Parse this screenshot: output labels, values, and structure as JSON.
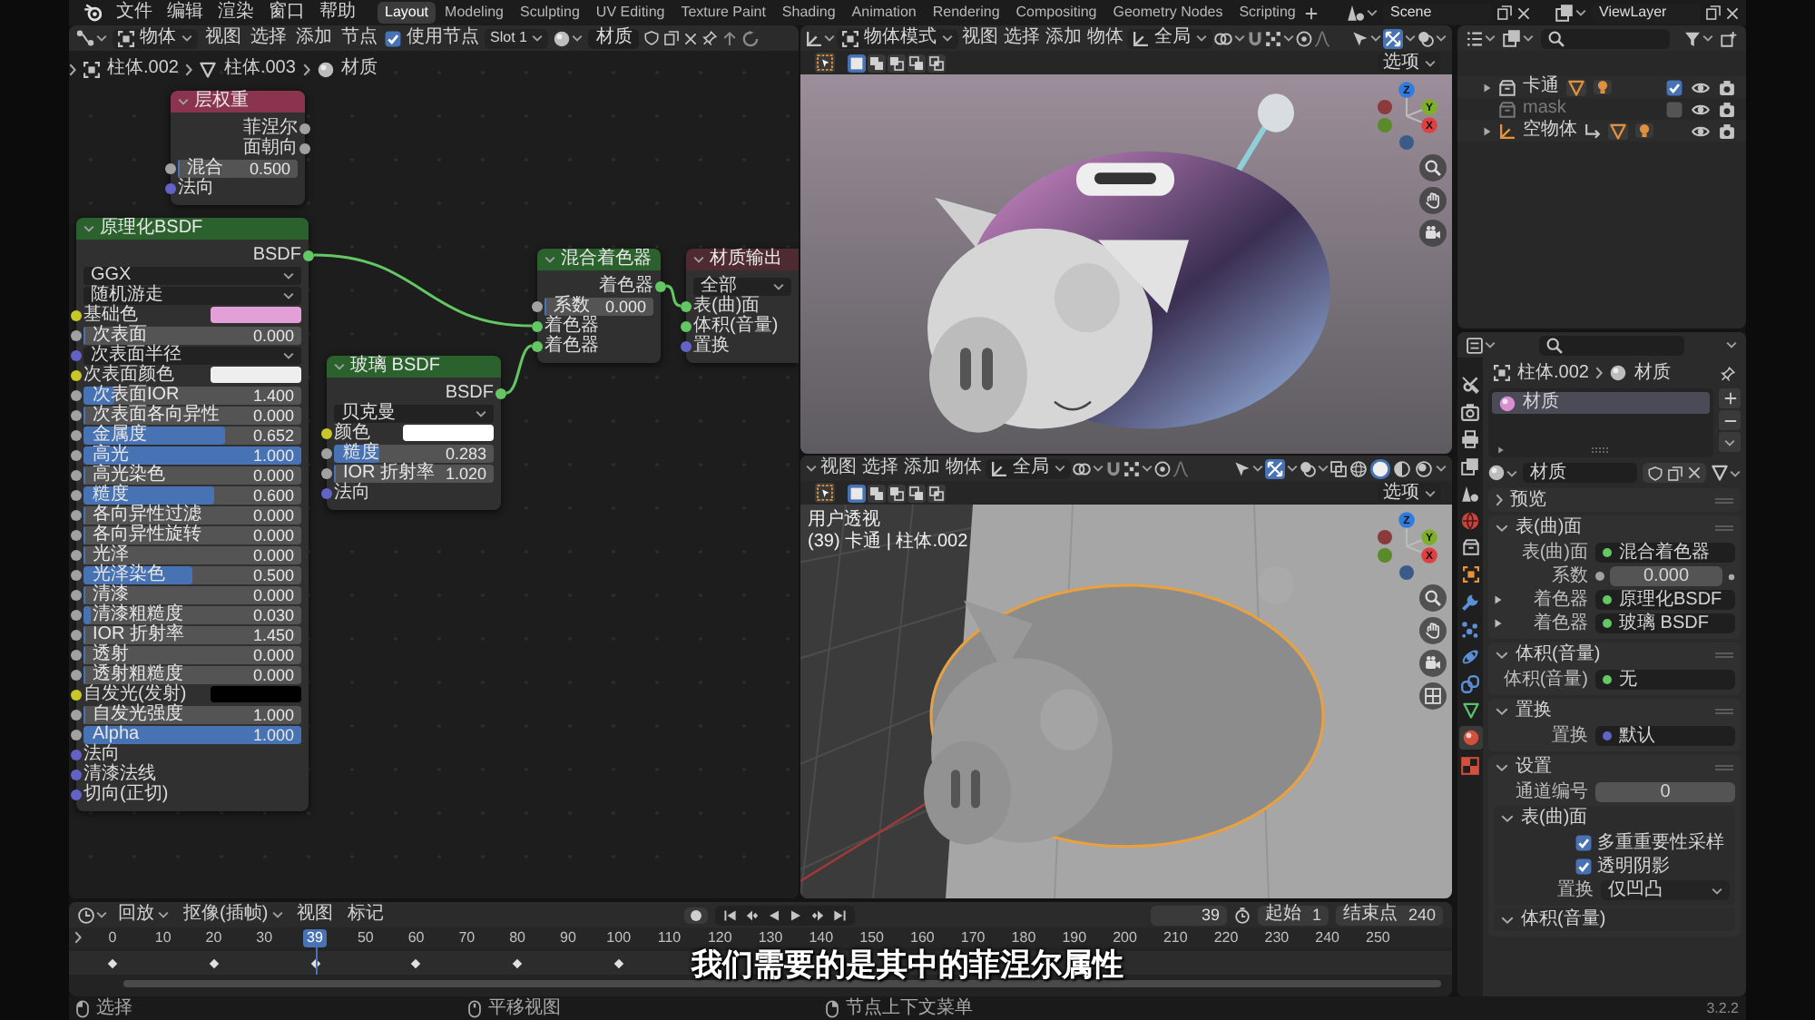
{
  "topbar": {
    "menus": [
      "文件",
      "编辑",
      "渲染",
      "窗口",
      "帮助"
    ],
    "workspaces": [
      {
        "label": "Layout",
        "selected": true
      },
      {
        "label": "Modeling",
        "selected": false
      },
      {
        "label": "Sculpting",
        "selected": false
      },
      {
        "label": "UV Editing",
        "selected": false
      },
      {
        "label": "Texture Paint",
        "selected": false
      },
      {
        "label": "Shading",
        "selected": false
      },
      {
        "label": "Animation",
        "selected": false
      },
      {
        "label": "Rendering",
        "selected": false
      },
      {
        "label": "Compositing",
        "selected": false
      },
      {
        "label": "Geometry Nodes",
        "selected": false
      },
      {
        "label": "Scripting",
        "selected": false
      }
    ],
    "scene": "Scene",
    "view_layer": "ViewLayer"
  },
  "node_editor": {
    "header": {
      "object_menu": "物体",
      "menus": [
        "视图",
        "选择",
        "添加",
        "节点"
      ],
      "use_nodes": {
        "label": "使用节点",
        "checked": true
      },
      "slot": "Slot 1",
      "material": "材质"
    },
    "breadcrumb": [
      {
        "label": "柱体.002",
        "kind": "object"
      },
      {
        "label": "柱体.003",
        "kind": "mesh"
      },
      {
        "label": "材质",
        "kind": "material"
      }
    ],
    "nodes": [
      {
        "title": "层权重",
        "kind": "input",
        "rows": [
          {
            "kind": "output",
            "label": "菲涅尔",
            "color": "#a1a1a1"
          },
          {
            "kind": "output",
            "label": "面朝向",
            "color": "#a1a1a1"
          },
          {
            "kind": "value",
            "label": "混合",
            "value": "0.500",
            "level": 0,
            "color": "#a1a1a1"
          },
          {
            "kind": "socket",
            "label": "法向",
            "color": "#6363c7"
          }
        ]
      },
      {
        "title": "原理化BSDF",
        "kind": "shader",
        "rows": [
          {
            "kind": "output",
            "label": "BSDF",
            "color": "#63c763",
            "linked": true
          },
          {
            "kind": "dropdown",
            "value": "GGX"
          },
          {
            "kind": "dropdown",
            "value": "随机游走"
          },
          {
            "kind": "color",
            "label": "基础色",
            "color": "#e3a0d8"
          },
          {
            "kind": "value",
            "label": "次表面",
            "value": "0.000",
            "level": 0,
            "color": "#a1a1a1"
          },
          {
            "kind": "menu",
            "label": "次表面半径",
            "color": "#6363c7"
          },
          {
            "kind": "color",
            "label": "次表面颜色",
            "color": "#eeeeee"
          },
          {
            "kind": "value",
            "label": "次表面IOR",
            "value": "1.400",
            "level": 0.14,
            "color": "#a1a1a1"
          },
          {
            "kind": "value",
            "label": "次表面各向异性",
            "value": "0.000",
            "level": 0,
            "color": "#a1a1a1"
          },
          {
            "kind": "value",
            "label": "金属度",
            "value": "0.652",
            "level": 0.652,
            "color": "#a1a1a1"
          },
          {
            "kind": "value",
            "label": "高光",
            "value": "1.000",
            "level": 1,
            "color": "#a1a1a1"
          },
          {
            "kind": "value",
            "label": "高光染色",
            "value": "0.000",
            "level": 0,
            "color": "#a1a1a1"
          },
          {
            "kind": "value",
            "label": "糙度",
            "value": "0.600",
            "level": 0.6,
            "color": "#a1a1a1"
          },
          {
            "kind": "value",
            "label": "各向异性过滤",
            "value": "0.000",
            "level": 0,
            "color": "#a1a1a1"
          },
          {
            "kind": "value",
            "label": "各向异性旋转",
            "value": "0.000",
            "level": 0,
            "color": "#a1a1a1"
          },
          {
            "kind": "value",
            "label": "光泽",
            "value": "0.000",
            "level": 0,
            "color": "#a1a1a1"
          },
          {
            "kind": "value",
            "label": "光泽染色",
            "value": "0.500",
            "level": 0.5,
            "color": "#a1a1a1"
          },
          {
            "kind": "value",
            "label": "清漆",
            "value": "0.000",
            "level": 0,
            "color": "#a1a1a1"
          },
          {
            "kind": "value",
            "label": "清漆粗糙度",
            "value": "0.030",
            "level": 0.03,
            "color": "#a1a1a1"
          },
          {
            "kind": "value",
            "label": "IOR 折射率",
            "value": "1.450",
            "level": 0,
            "color": "#a1a1a1"
          },
          {
            "kind": "value",
            "label": "透射",
            "value": "0.000",
            "level": 0,
            "color": "#a1a1a1"
          },
          {
            "kind": "value",
            "label": "透射粗糙度",
            "value": "0.000",
            "level": 0,
            "color": "#a1a1a1"
          },
          {
            "kind": "color",
            "label": "自发光(发射)",
            "color": "#000000"
          },
          {
            "kind": "value",
            "label": "自发光强度",
            "value": "1.000",
            "level": 0,
            "color": "#a1a1a1"
          },
          {
            "kind": "value",
            "label": "Alpha",
            "value": "1.000",
            "level": 1,
            "color": "#a1a1a1"
          },
          {
            "kind": "socket",
            "label": "法向",
            "color": "#6363c7"
          },
          {
            "kind": "socket",
            "label": "清漆法线",
            "color": "#6363c7"
          },
          {
            "kind": "socket",
            "label": "切向(正切)",
            "color": "#6363c7"
          }
        ]
      },
      {
        "title": "玻璃 BSDF",
        "kind": "shader",
        "rows": [
          {
            "kind": "output",
            "label": "BSDF",
            "color": "#63c763",
            "linked": true
          },
          {
            "kind": "dropdown",
            "value": "贝克曼"
          },
          {
            "kind": "color",
            "label": "颜色",
            "color": "#ffffff"
          },
          {
            "kind": "value",
            "label": "糙度",
            "value": "0.283",
            "level": 0.283,
            "color": "#a1a1a1"
          },
          {
            "kind": "value",
            "label": "IOR 折射率",
            "value": "1.020",
            "level": 0,
            "color": "#a1a1a1"
          },
          {
            "kind": "socket",
            "label": "法向",
            "color": "#6363c7"
          }
        ]
      },
      {
        "title": "混合着色器",
        "kind": "shader",
        "rows": [
          {
            "kind": "output",
            "label": "着色器",
            "color": "#63c763",
            "linked": true
          },
          {
            "kind": "value",
            "label": "系数",
            "value": "0.000",
            "level": 0,
            "color": "#a1a1a1"
          },
          {
            "kind": "socket",
            "label": "着色器",
            "color": "#63c763",
            "linked": true
          },
          {
            "kind": "socket",
            "label": "着色器",
            "color": "#63c763",
            "linked": true
          }
        ]
      },
      {
        "title": "材质输出",
        "kind": "output",
        "rows": [
          {
            "kind": "dropdown",
            "value": "全部"
          },
          {
            "kind": "socket",
            "label": "表(曲)面",
            "color": "#63c763",
            "linked": true
          },
          {
            "kind": "socket",
            "label": "体积(音量)",
            "color": "#63c763"
          },
          {
            "kind": "socket",
            "label": "置换",
            "color": "#6363c7"
          }
        ]
      }
    ]
  },
  "viewport_top": {
    "mode": "物体模式",
    "menus": [
      "视图",
      "选择",
      "添加",
      "物体"
    ],
    "orientation": "全局",
    "select_modes": [
      {
        "kind": "set",
        "selected": true
      },
      {
        "kind": "extend",
        "selected": false
      },
      {
        "kind": "subtract",
        "selected": false
      },
      {
        "kind": "invert",
        "selected": false
      },
      {
        "kind": "intersect",
        "selected": false
      }
    ],
    "options": "选项",
    "gizmo": [
      "Z",
      "Y",
      "X"
    ]
  },
  "viewport_bottom": {
    "menus": [
      "视图",
      "选择",
      "添加",
      "物体"
    ],
    "orientation": "全局",
    "shading": [
      {
        "kind": "wireframe",
        "selected": false
      },
      {
        "kind": "solid",
        "selected": true
      },
      {
        "kind": "material",
        "selected": false
      },
      {
        "kind": "rendered",
        "selected": false
      }
    ],
    "select_modes": [
      {
        "kind": "set",
        "selected": true
      },
      {
        "kind": "extend",
        "selected": false
      },
      {
        "kind": "subtract",
        "selected": false
      },
      {
        "kind": "invert",
        "selected": false
      },
      {
        "kind": "intersect",
        "selected": false
      }
    ],
    "options": "选项",
    "info": [
      "用户透视",
      "(39) 卡通 | 柱体.002"
    ],
    "gizmo": [
      "Z",
      "Y",
      "X"
    ]
  },
  "outliner": {
    "rows": [
      {
        "label": "卡通",
        "kind": "collection",
        "expanded": false,
        "checked": true
      },
      {
        "label": "mask",
        "kind": "plain",
        "checked": false
      },
      {
        "label": "空物体",
        "kind": "empty",
        "expanded": false
      }
    ]
  },
  "properties": {
    "tabs": [
      {
        "kind": "tool",
        "selected": false
      },
      {
        "kind": "render",
        "selected": false
      },
      {
        "kind": "output",
        "selected": false
      },
      {
        "kind": "view_layer",
        "selected": false
      },
      {
        "kind": "scene",
        "selected": false
      },
      {
        "kind": "world",
        "selected": false
      },
      {
        "kind": "collection",
        "selected": false
      },
      {
        "kind": "object",
        "selected": false
      },
      {
        "kind": "modifiers",
        "selected": false
      },
      {
        "kind": "particles",
        "selected": false
      },
      {
        "kind": "physics",
        "selected": false
      },
      {
        "kind": "constraints",
        "selected": false
      },
      {
        "kind": "data",
        "selected": false
      },
      {
        "kind": "material",
        "selected": true
      },
      {
        "kind": "texture",
        "selected": false
      }
    ],
    "breadcrumb": [
      {
        "label": "柱体.002",
        "kind": "object"
      },
      {
        "label": "材质",
        "kind": "material"
      }
    ],
    "slots": [
      {
        "label": "材质",
        "selected": true
      }
    ],
    "material": "材质",
    "panels": [
      {
        "title": "预览",
        "expanded": false
      },
      {
        "title": "表(曲)面",
        "expanded": true,
        "rows": [
          {
            "kind": "link",
            "label": "表(曲)面",
            "value": "混合着色器",
            "color": "#63c763"
          },
          {
            "kind": "number",
            "label": "系数",
            "value": "0.000",
            "color": "#a1a1a1"
          },
          {
            "kind": "link",
            "label": "着色器",
            "value": "原理化BSDF",
            "color": "#63c763",
            "expanded": false
          },
          {
            "kind": "link",
            "label": "着色器",
            "value": "玻璃 BSDF",
            "color": "#63c763",
            "expanded": false
          }
        ]
      },
      {
        "title": "体积(音量)",
        "expanded": true,
        "rows": [
          {
            "kind": "link",
            "label": "体积(音量)",
            "value": "无",
            "color": "#63c763"
          }
        ]
      },
      {
        "title": "置换",
        "expanded": true,
        "rows": [
          {
            "kind": "link",
            "label": "置换",
            "value": "默认",
            "color": "#6363c7"
          }
        ]
      },
      {
        "title": "设置",
        "expanded": true,
        "rows": [
          {
            "kind": "number",
            "label": "通道编号",
            "value": "0"
          }
        ],
        "subpanels": [
          {
            "title": "表(曲)面",
            "expanded": true,
            "rows": [
              {
                "kind": "check",
                "label": "多重重要性采样",
                "checked": true
              },
              {
                "kind": "check",
                "label": "透明阴影",
                "checked": true
              },
              {
                "kind": "menu",
                "label": "置换",
                "value": "仅凹凸"
              }
            ]
          },
          {
            "title": "体积(音量)",
            "expanded": true
          }
        ]
      }
    ]
  },
  "timeline": {
    "menus": [
      {
        "label": "回放",
        "kind": "dropdown"
      },
      {
        "label": "抠像(插帧)",
        "kind": "dropdown"
      },
      {
        "label": "视图",
        "kind": "menu"
      },
      {
        "label": "标记",
        "kind": "menu"
      }
    ],
    "current_frame": "39",
    "start_label": "起始",
    "start": "1",
    "end_label": "结束点",
    "end": "240",
    "ruler": [
      {
        "label": "0",
        "selected": false,
        "keyframe": true
      },
      {
        "label": "10",
        "selected": false,
        "keyframe": false
      },
      {
        "label": "20",
        "selected": false,
        "keyframe": true
      },
      {
        "label": "30",
        "selected": false,
        "keyframe": false
      },
      {
        "label": "39",
        "selected": true,
        "keyframe": true
      },
      {
        "label": "50",
        "selected": false,
        "keyframe": false
      },
      {
        "label": "60",
        "selected": false,
        "keyframe": true
      },
      {
        "label": "70",
        "selected": false,
        "keyframe": false
      },
      {
        "label": "80",
        "selected": false,
        "keyframe": true
      },
      {
        "label": "90",
        "selected": false,
        "keyframe": false
      },
      {
        "label": "100",
        "selected": false,
        "keyframe": true
      },
      {
        "label": "110",
        "selected": false,
        "keyframe": false
      },
      {
        "label": "120",
        "selected": false,
        "keyframe": false
      },
      {
        "label": "130",
        "selected": false,
        "keyframe": false
      },
      {
        "label": "140",
        "selected": false,
        "keyframe": false
      },
      {
        "label": "150",
        "selected": false,
        "keyframe": false
      },
      {
        "label": "160",
        "selected": false,
        "keyframe": false
      },
      {
        "label": "170",
        "selected": false,
        "keyframe": false
      },
      {
        "label": "180",
        "selected": false,
        "keyframe": false
      },
      {
        "label": "190",
        "selected": false,
        "keyframe": false
      },
      {
        "label": "200",
        "selected": false,
        "keyframe": false
      },
      {
        "label": "210",
        "selected": false,
        "keyframe": false
      },
      {
        "label": "220",
        "selected": false,
        "keyframe": false
      },
      {
        "label": "230",
        "selected": false,
        "keyframe": false
      },
      {
        "label": "240",
        "selected": false,
        "keyframe": false
      },
      {
        "label": "250",
        "selected": false,
        "keyframe": false
      }
    ]
  },
  "subtitle": "我们需要的是其中的菲涅尔属性",
  "status_bar": {
    "items": [
      {
        "label": "选择",
        "kind": "left"
      },
      {
        "label": "平移视图",
        "kind": "middle"
      },
      {
        "label": "节点上下文菜单",
        "kind": "right"
      }
    ],
    "version": "3.2.2"
  }
}
